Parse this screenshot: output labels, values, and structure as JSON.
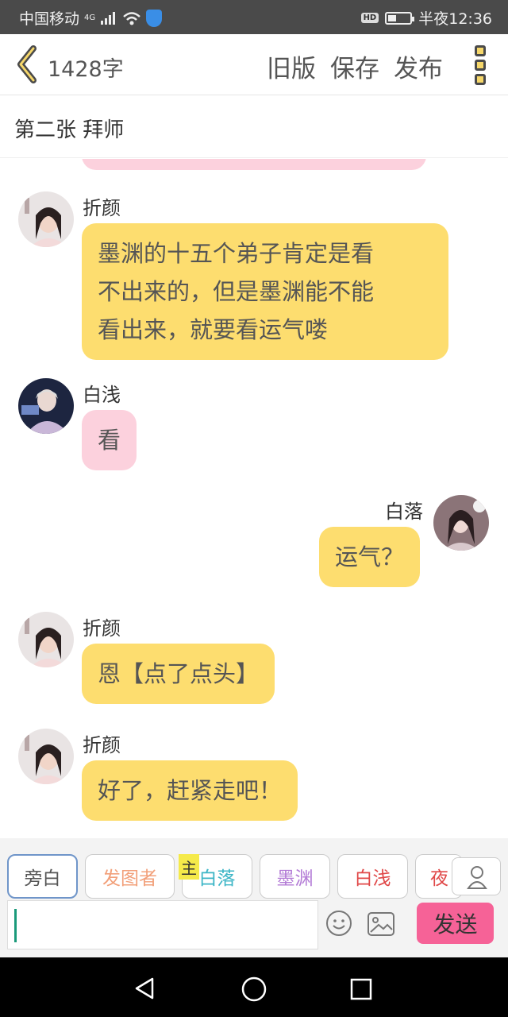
{
  "status": {
    "carrier": "中国移动",
    "network": "4G",
    "time": "半夜12:36"
  },
  "header": {
    "word_count": "1428字",
    "actions": [
      "旧版",
      "保存",
      "发布"
    ]
  },
  "chapter_title": "第二张 拜师",
  "messages": [
    {
      "name": "折颜",
      "lines": [
        "墨渊的十五个弟子肯定是看",
        "不出来的，但是墨渊能不能",
        "看出来，就要看运气喽"
      ]
    },
    {
      "name": "白浅",
      "text": "看"
    },
    {
      "name": "白落",
      "text": "运气？"
    },
    {
      "name": "折颜",
      "text": "恩【点了点头】"
    },
    {
      "name": "折颜",
      "text": "好了，赶紧走吧！"
    }
  ],
  "roles": [
    "旁白",
    "发图者",
    "白落",
    "墨渊",
    "白浅",
    "夜"
  ],
  "role_colors": [
    "#555555",
    "#f2a07a",
    "#3bb5c6",
    "#b37bd6",
    "#e04848",
    "#e04848"
  ],
  "main_badge": "主",
  "send_label": "发送",
  "colors": {
    "yellow_bubble": "#fddd6f",
    "pink_bubble": "#fcd1dd",
    "send": "#f66297"
  }
}
